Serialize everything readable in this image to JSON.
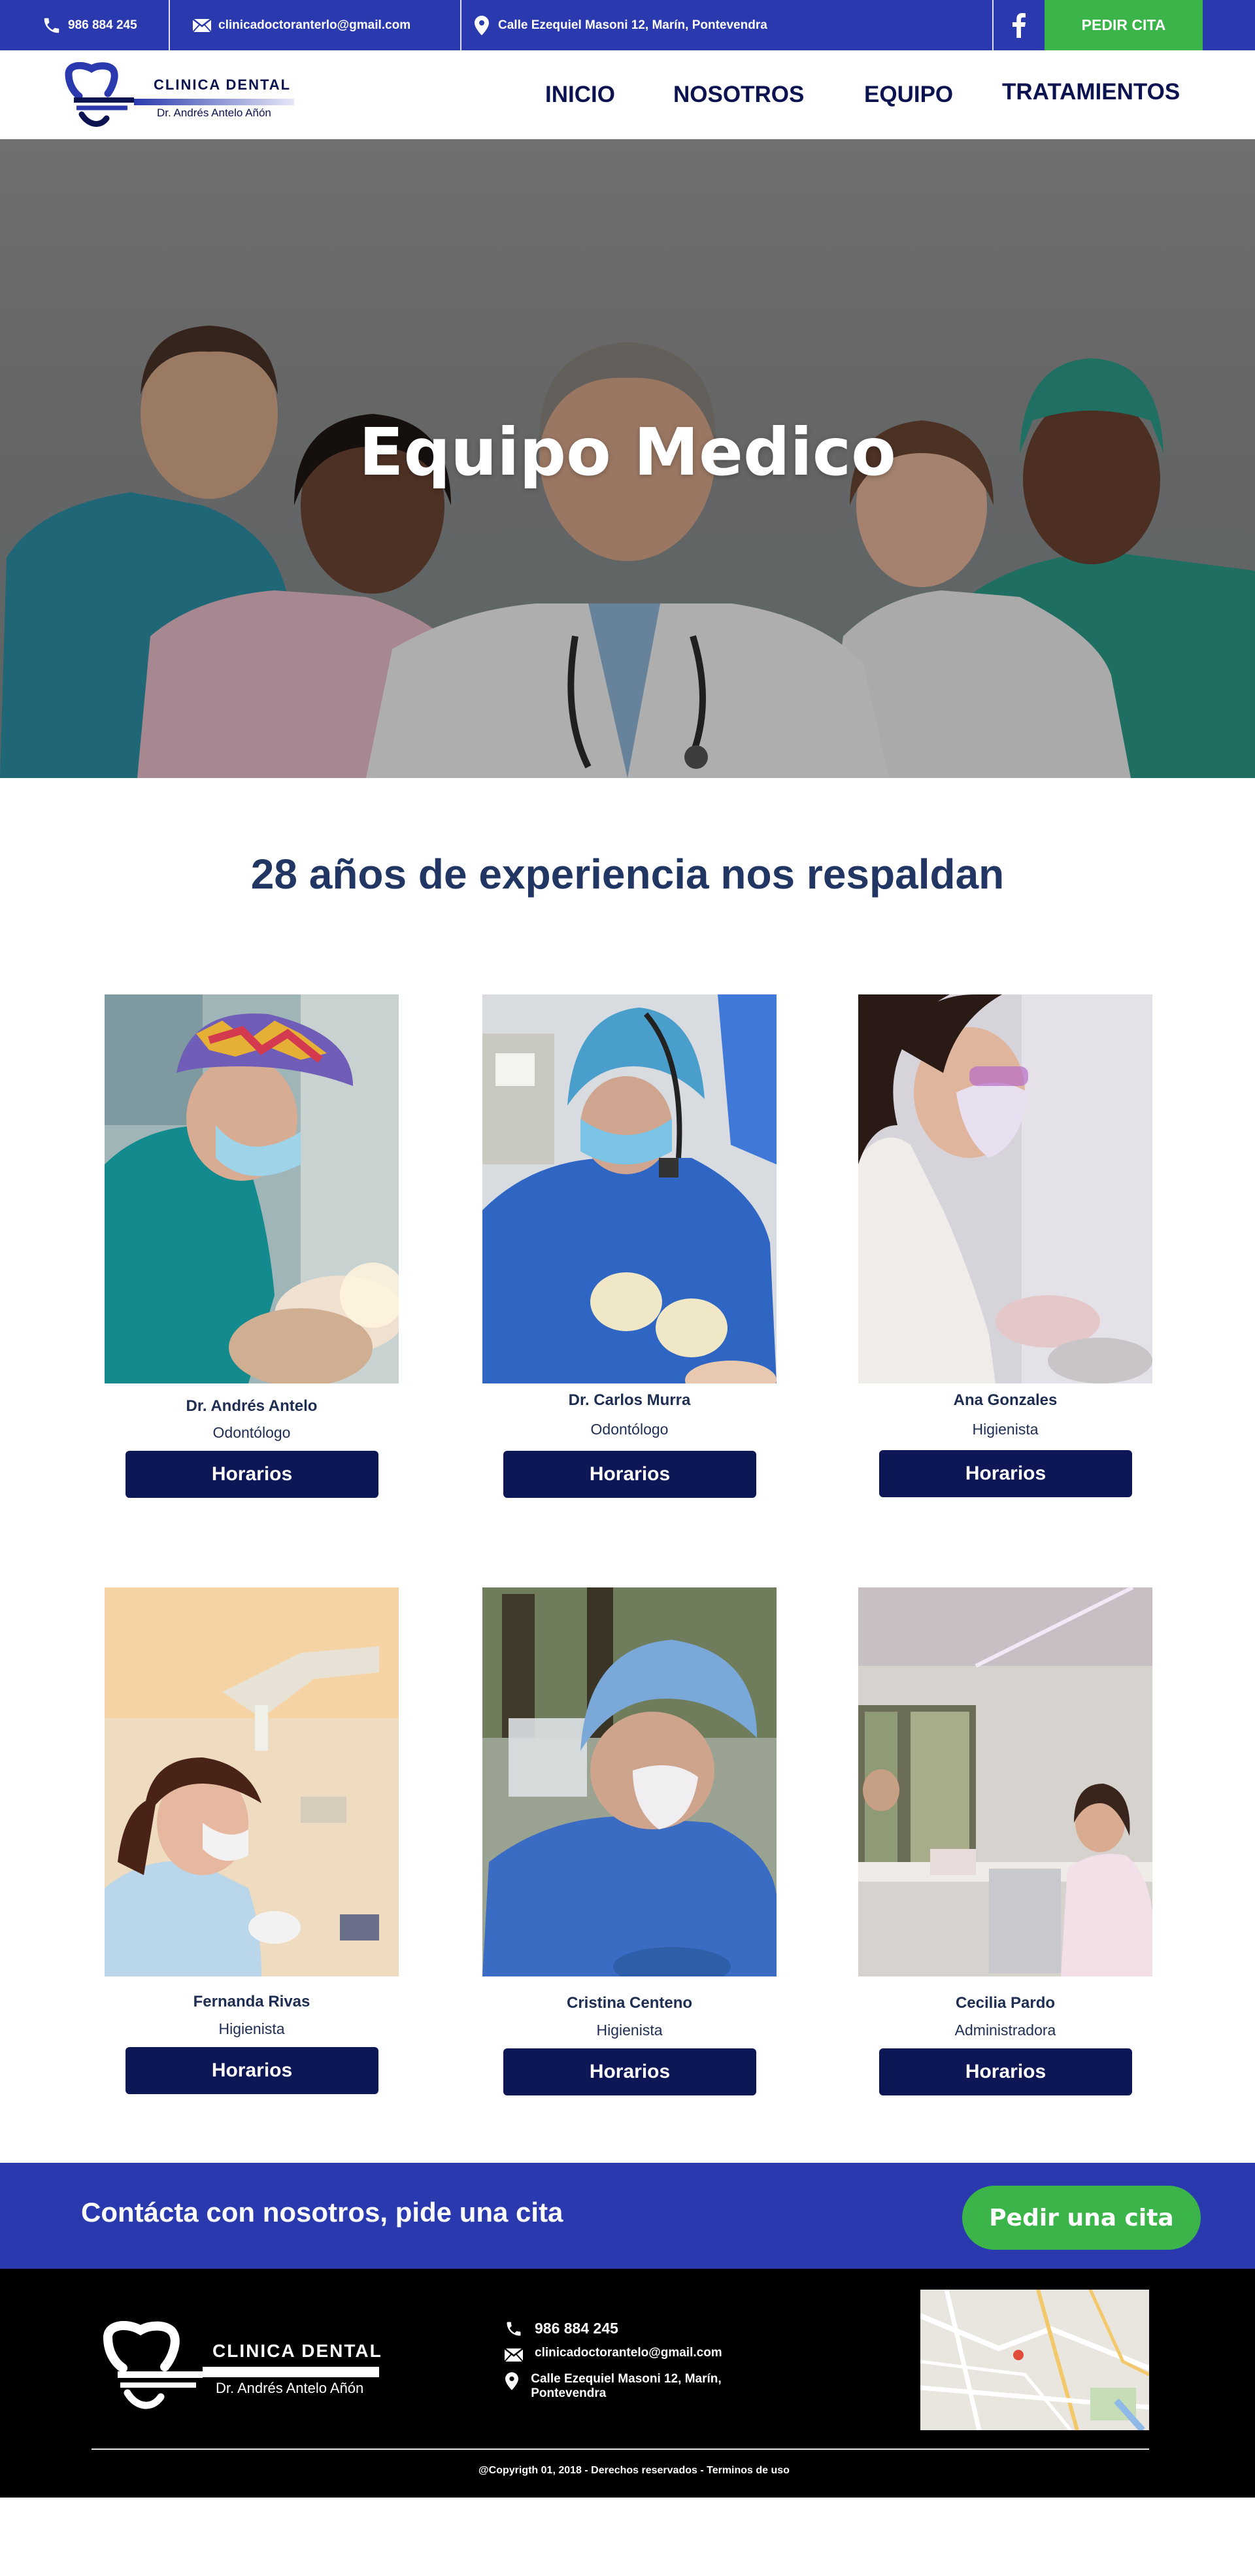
{
  "topbar": {
    "phone": "986 884 245",
    "email": "clinicadoctoranterlo@gmail.com",
    "address": "Calle Ezequiel Masoni 12, Marín, Pontevendra",
    "cta": "PEDIR CITA"
  },
  "header": {
    "logo_title": "CLINICA DENTAL",
    "logo_subtitle": "Dr. Andrés Antelo Añón",
    "nav": [
      "INICIO",
      "NOSOTROS",
      "EQUIPO",
      "TRATAMIENTOS"
    ]
  },
  "hero": {
    "title": "Equipo Medico"
  },
  "main": {
    "heading": "28 años de experiencia nos respaldan"
  },
  "team": [
    {
      "name": "Dr. Andrés Antelo",
      "role": "Odontólogo",
      "button": "Horarios"
    },
    {
      "name": "Dr. Carlos Murra",
      "role": "Odontólogo",
      "button": "Horarios"
    },
    {
      "name": "Ana Gonzales",
      "role": "Higienista",
      "button": "Horarios"
    },
    {
      "name": "Fernanda Rivas",
      "role": "Higienista",
      "button": "Horarios"
    },
    {
      "name": "Cristina Centeno",
      "role": "Higienista",
      "button": "Horarios"
    },
    {
      "name": "Cecilia Pardo",
      "role": "Administradora",
      "button": "Horarios"
    }
  ],
  "contact_band": {
    "text": "Contácta con nosotros, pide una cita",
    "button": "Pedir una cita"
  },
  "footer": {
    "logo_title": "CLINICA DENTAL",
    "logo_subtitle": "Dr. Andrés Antelo Añón",
    "phone": "986 884 245",
    "email": "clinicadoctorantelo@gmail.com",
    "address": "Calle Ezequiel Masoni 12, Marín, Pontevendra",
    "copyright": "@Copyrigth 01, 2018 - Derechos reservados - Terminos de uso"
  },
  "colors": {
    "brand_blue": "#2a3aae",
    "navy": "#0e1756",
    "green": "#3bb54a"
  }
}
